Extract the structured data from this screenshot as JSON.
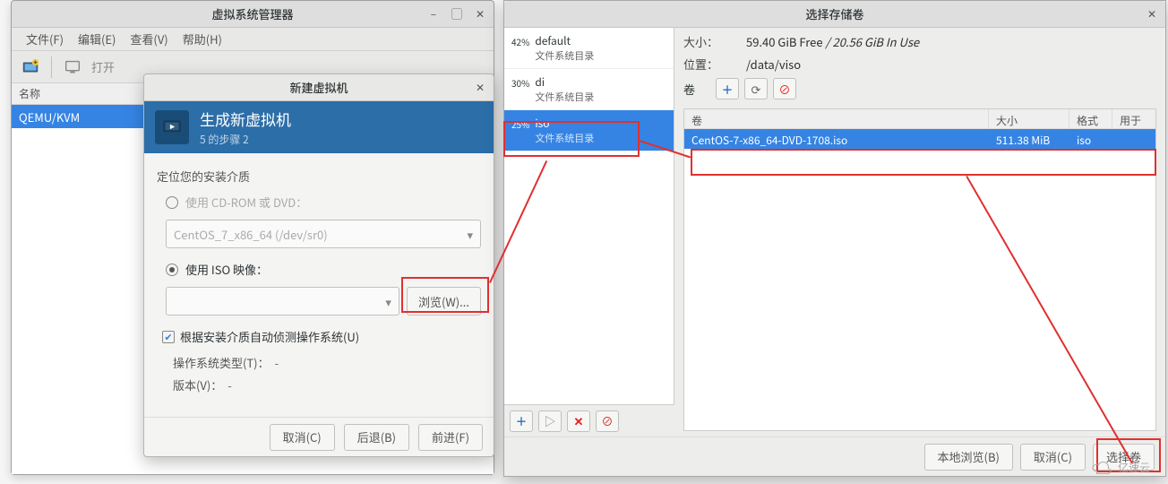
{
  "vmgr": {
    "title": "虚拟系统管理器",
    "menus": {
      "file": "文件(F)",
      "edit": "编辑(E)",
      "view": "查看(V)",
      "help": "帮助(H)"
    },
    "open_label": "打开",
    "column_name": "名称",
    "row0": "QEMU/KVM"
  },
  "newvm": {
    "title": "新建虚拟机",
    "banner_title": "生成新虚拟机",
    "banner_sub": "5 的步骤 2",
    "locate_label": "定位您的安装介质",
    "opt_cd_label": "使用 CD-ROM 或 DVD：",
    "cd_combo": "CentOS_7_x86_64 (/dev/sr0)",
    "opt_iso_label": "使用 ISO 映像：",
    "browse_btn": "浏览(W)...",
    "autodetect_label": "根据安装介质自动侦测操作系统(U)",
    "os_type_label": "操作系统类型(T)：",
    "os_type_value": "-",
    "version_label": "版本(V)：",
    "version_value": "-",
    "cancel": "取消(C)",
    "back": "后退(B)",
    "forward": "前进(F)"
  },
  "sv": {
    "title": "选择存储卷",
    "pools": [
      {
        "pct": "42%",
        "name": "default",
        "sub": "文件系统目录"
      },
      {
        "pct": "30%",
        "name": "di",
        "sub": "文件系统目录"
      },
      {
        "pct": "25%",
        "name": "iso",
        "sub": "文件系统目录"
      }
    ],
    "size_label": "大小：",
    "size_value_free": "59.40 GiB Free ",
    "size_value_used": "/ 20.56 GiB In Use",
    "loc_label": "位置：",
    "loc_value": "/data/viso",
    "vol_label": "卷",
    "hdr_name": "卷",
    "hdr_size": "大小",
    "hdr_fmt": "格式",
    "hdr_use": "用于",
    "row": {
      "name": "CentOS-7-x86_64-DVD-1708.iso",
      "size": "511.38 MiB",
      "fmt": "iso",
      "use": ""
    },
    "local_browse": "本地浏览(B)",
    "cancel": "取消(C)",
    "choose": "选择卷"
  },
  "watermark": "亿速云"
}
